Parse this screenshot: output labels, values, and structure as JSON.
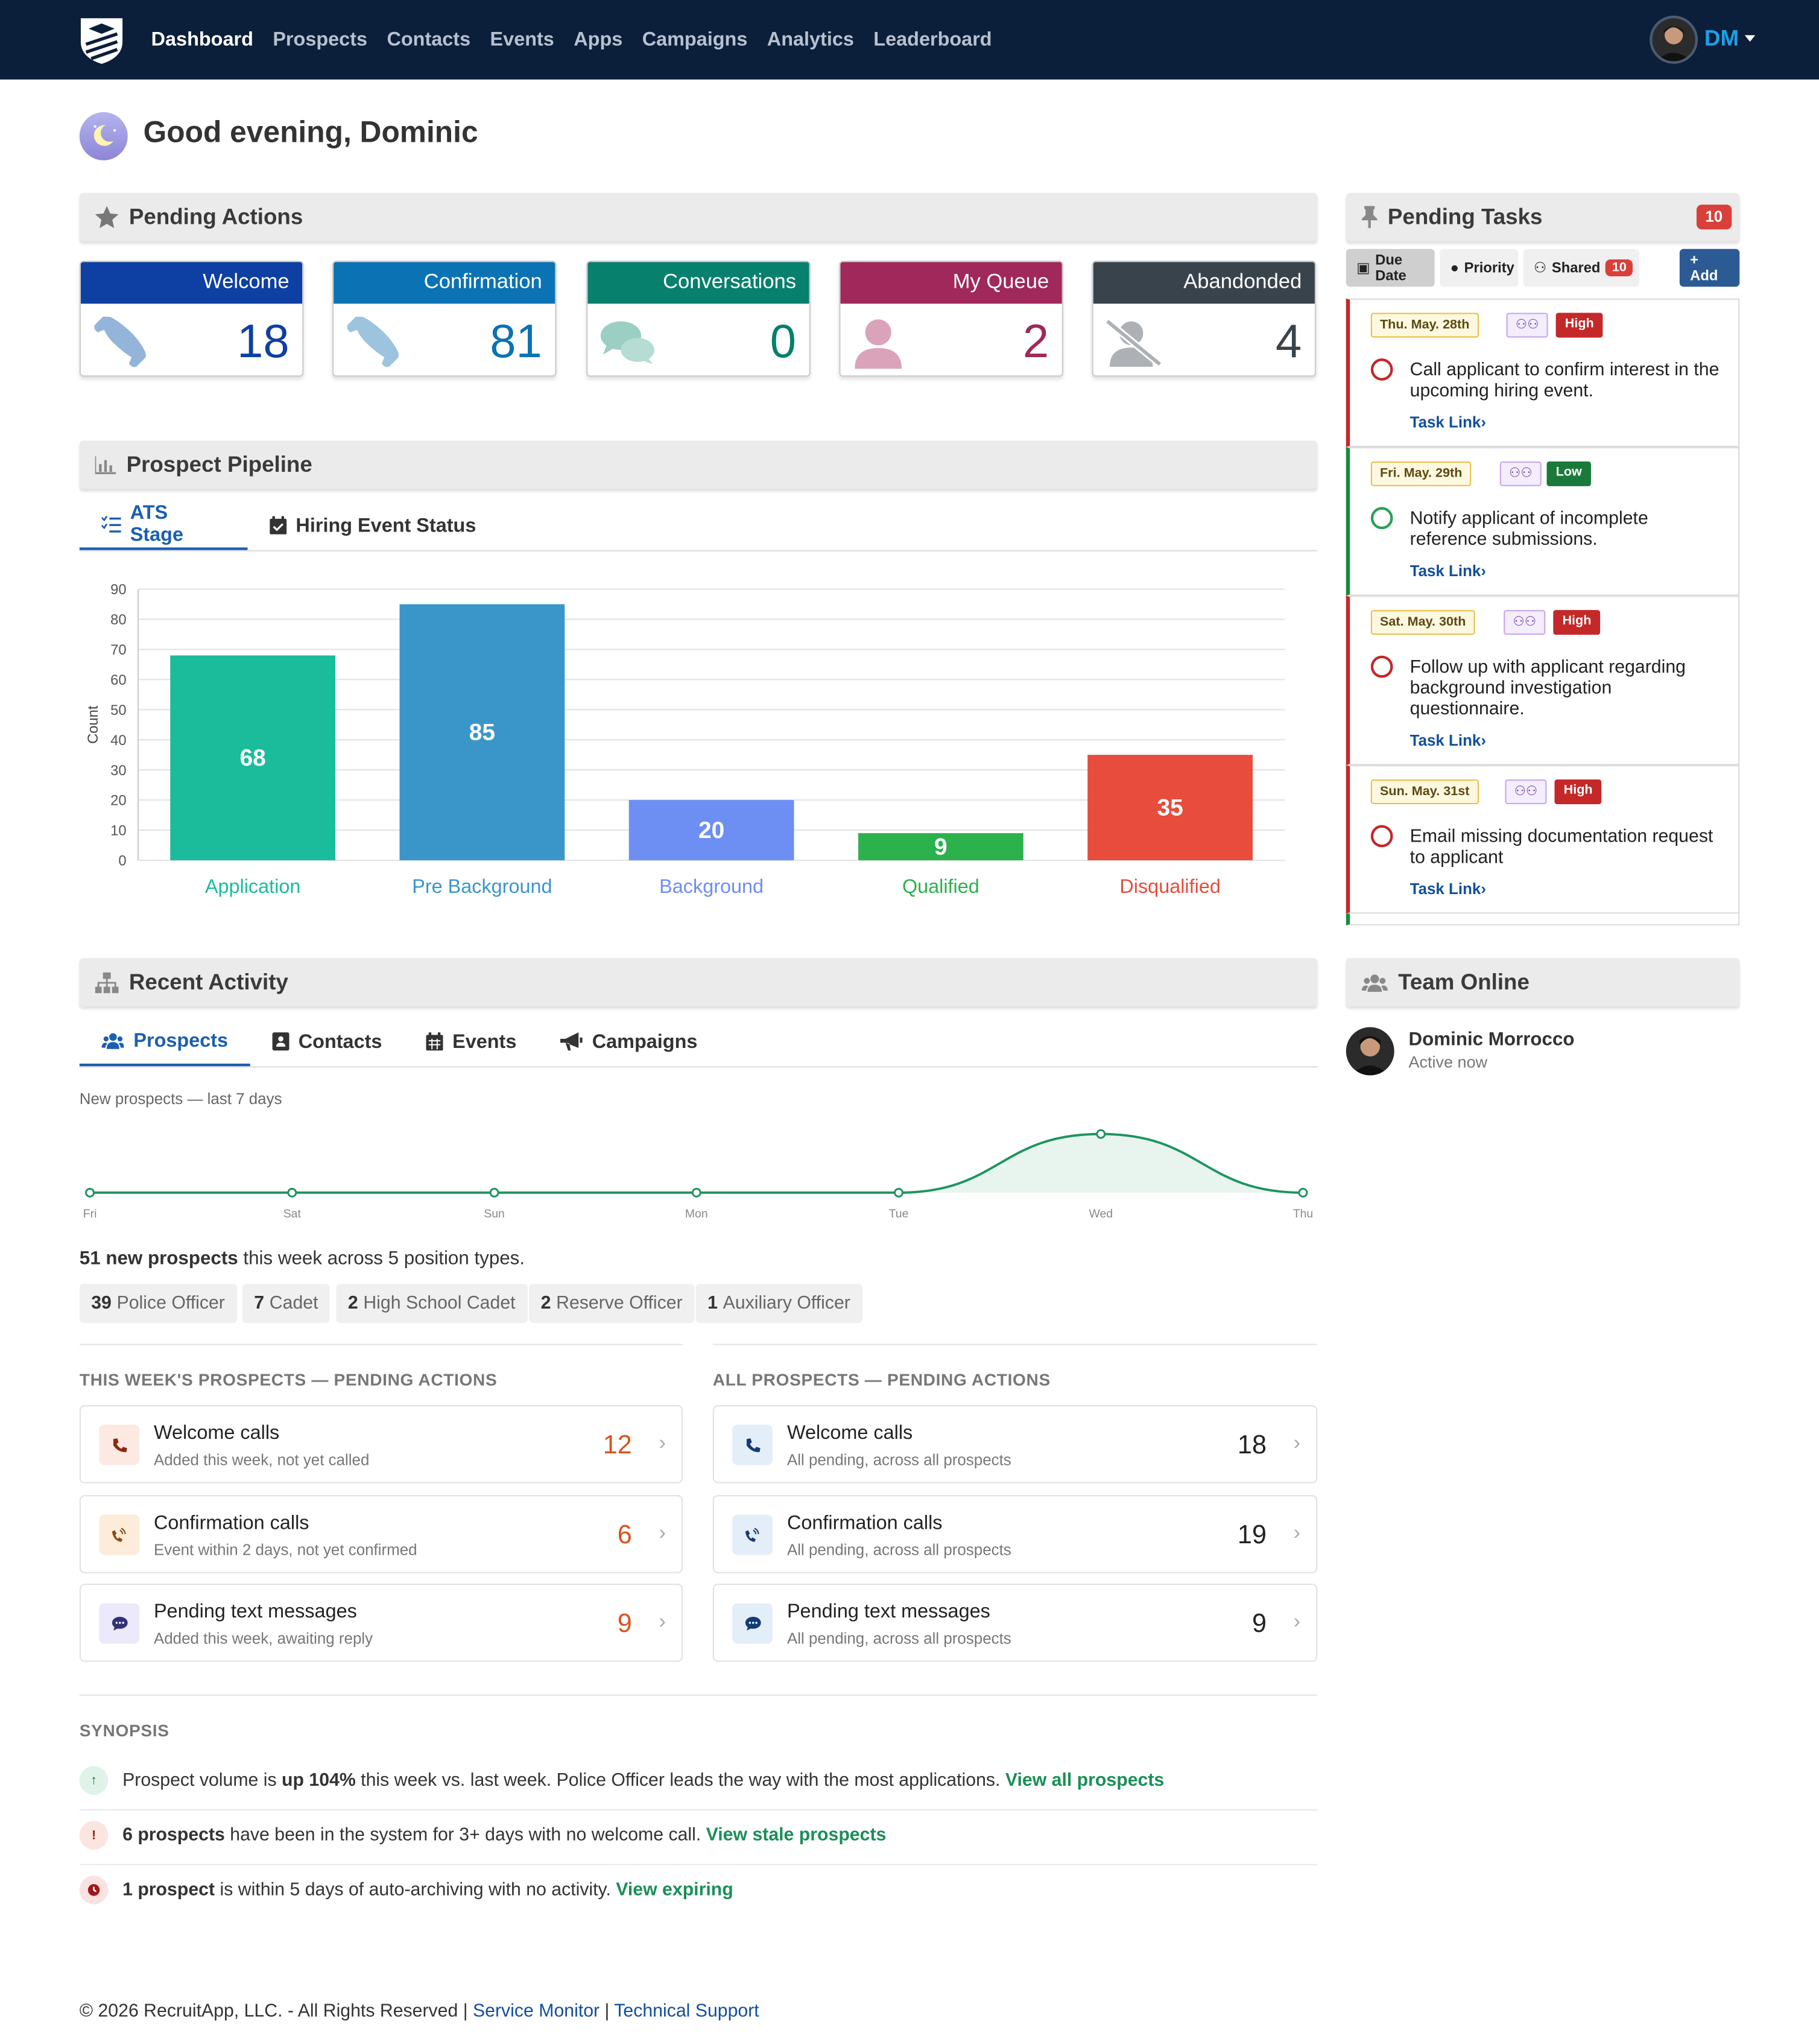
{
  "nav": {
    "links": [
      "Dashboard",
      "Prospects",
      "Contacts",
      "Events",
      "Apps",
      "Campaigns",
      "Analytics",
      "Leaderboard"
    ],
    "initials": "DM"
  },
  "greeting": "Good evening, Dominic",
  "pending_actions": {
    "title": "Pending Actions",
    "cards": [
      {
        "label": "Welcome",
        "value": "18",
        "color": "#0e3fa3",
        "icon": "phone-icon"
      },
      {
        "label": "Confirmation",
        "value": "81",
        "color": "#0b72b4",
        "icon": "phone-icon"
      },
      {
        "label": "Conversations",
        "value": "0",
        "color": "#07806e",
        "icon": "chat-icon"
      },
      {
        "label": "My Queue",
        "value": "2",
        "color": "#a0285a",
        "icon": "user-icon"
      },
      {
        "label": "Abandonded",
        "value": "4",
        "color": "#39434c",
        "icon": "user-slash-icon"
      }
    ]
  },
  "pipeline": {
    "title": "Prospect Pipeline",
    "tabs": [
      "ATS Stage",
      "Hiring Event Status"
    ]
  },
  "chart_data": {
    "type": "bar",
    "categories": [
      "Application",
      "Pre Background",
      "Background",
      "Qualified",
      "Disqualified"
    ],
    "values": [
      68,
      85,
      20,
      9,
      35
    ],
    "colors": [
      "#1abc9c",
      "#3a96c8",
      "#6d8ef3",
      "#2bb24c",
      "#e74c3c"
    ],
    "ylabel": "Count",
    "ylim": [
      0,
      90
    ],
    "yticks": [
      0,
      10,
      20,
      30,
      40,
      50,
      60,
      70,
      80,
      90
    ]
  },
  "recent": {
    "title": "Recent Activity",
    "tabs": [
      "Prospects",
      "Contacts",
      "Events",
      "Campaigns"
    ],
    "spark_label": "New prospects — last 7 days",
    "spark": {
      "type": "area",
      "x": [
        "Fri",
        "Sat",
        "Sun",
        "Mon",
        "Tue",
        "Wed",
        "Thu"
      ],
      "values": [
        0,
        0,
        0,
        0,
        0,
        51,
        0
      ]
    },
    "summary_bold": "51 new prospects",
    "summary_rest": " this week across 5 position types.",
    "positions": [
      {
        "n": "39",
        "label": "Police Officer"
      },
      {
        "n": "7",
        "label": "Cadet"
      },
      {
        "n": "2",
        "label": "High School Cadet"
      },
      {
        "n": "2",
        "label": "Reserve Officer"
      },
      {
        "n": "1",
        "label": "Auxiliary Officer"
      }
    ]
  },
  "week_actions": {
    "title": "THIS WEEK'S PROSPECTS — PENDING ACTIONS",
    "rows": [
      {
        "title": "Welcome calls",
        "sub": "Added this week, not yet called",
        "count": "12"
      },
      {
        "title": "Confirmation calls",
        "sub": "Event within 2 days, not yet confirmed",
        "count": "6"
      },
      {
        "title": "Pending text messages",
        "sub": "Added this week, awaiting reply",
        "count": "9"
      }
    ]
  },
  "all_actions": {
    "title": "ALL PROSPECTS — PENDING ACTIONS",
    "rows": [
      {
        "title": "Welcome calls",
        "sub": "All pending, across all prospects",
        "count": "18"
      },
      {
        "title": "Confirmation calls",
        "sub": "All pending, across all prospects",
        "count": "19"
      },
      {
        "title": "Pending text messages",
        "sub": "All pending, across all prospects",
        "count": "9"
      }
    ]
  },
  "synopsis": {
    "title": "SYNOPSIS",
    "items": [
      {
        "a": "Prospect volume is ",
        "b": "up 104%",
        "c": " this week vs. last week. Police Officer leads the way with the most applications. ",
        "link": "View all prospects"
      },
      {
        "a": "",
        "b": "6 prospects",
        "c": " have been in the system for 3+ days with no welcome call. ",
        "link": "View stale prospects"
      },
      {
        "a": "",
        "b": "1 prospect",
        "c": " is within 5 days of auto-archiving with no activity. ",
        "link": "View expiring"
      }
    ]
  },
  "tasks": {
    "title": "Pending Tasks",
    "count": "10",
    "buttons": {
      "due": "Due Date",
      "priority": "Priority",
      "shared": "Shared",
      "shared_count": "10",
      "add": "+ Add"
    },
    "link_label": "Task Link›",
    "items": [
      {
        "date": "Thu. May. 28th",
        "priority": "High",
        "text": "Call applicant to confirm interest in the upcoming hiring event."
      },
      {
        "date": "Fri. May. 29th",
        "priority": "Low",
        "text": "Notify applicant of incomplete reference submissions."
      },
      {
        "date": "Sat. May. 30th",
        "priority": "High",
        "text": "Follow up with applicant regarding background investigation questionnaire."
      },
      {
        "date": "Sun. May. 31st",
        "priority": "High",
        "text": "Email missing documentation request to applicant"
      }
    ]
  },
  "team": {
    "title": "Team Online",
    "name": "Dominic Morrocco",
    "status": "Active now"
  },
  "footer": {
    "text": "© 2026 RecruitApp, LLC. - All Rights Reserved | ",
    "link1": "Service Monitor",
    "sep": " | ",
    "link2": "Technical Support"
  }
}
